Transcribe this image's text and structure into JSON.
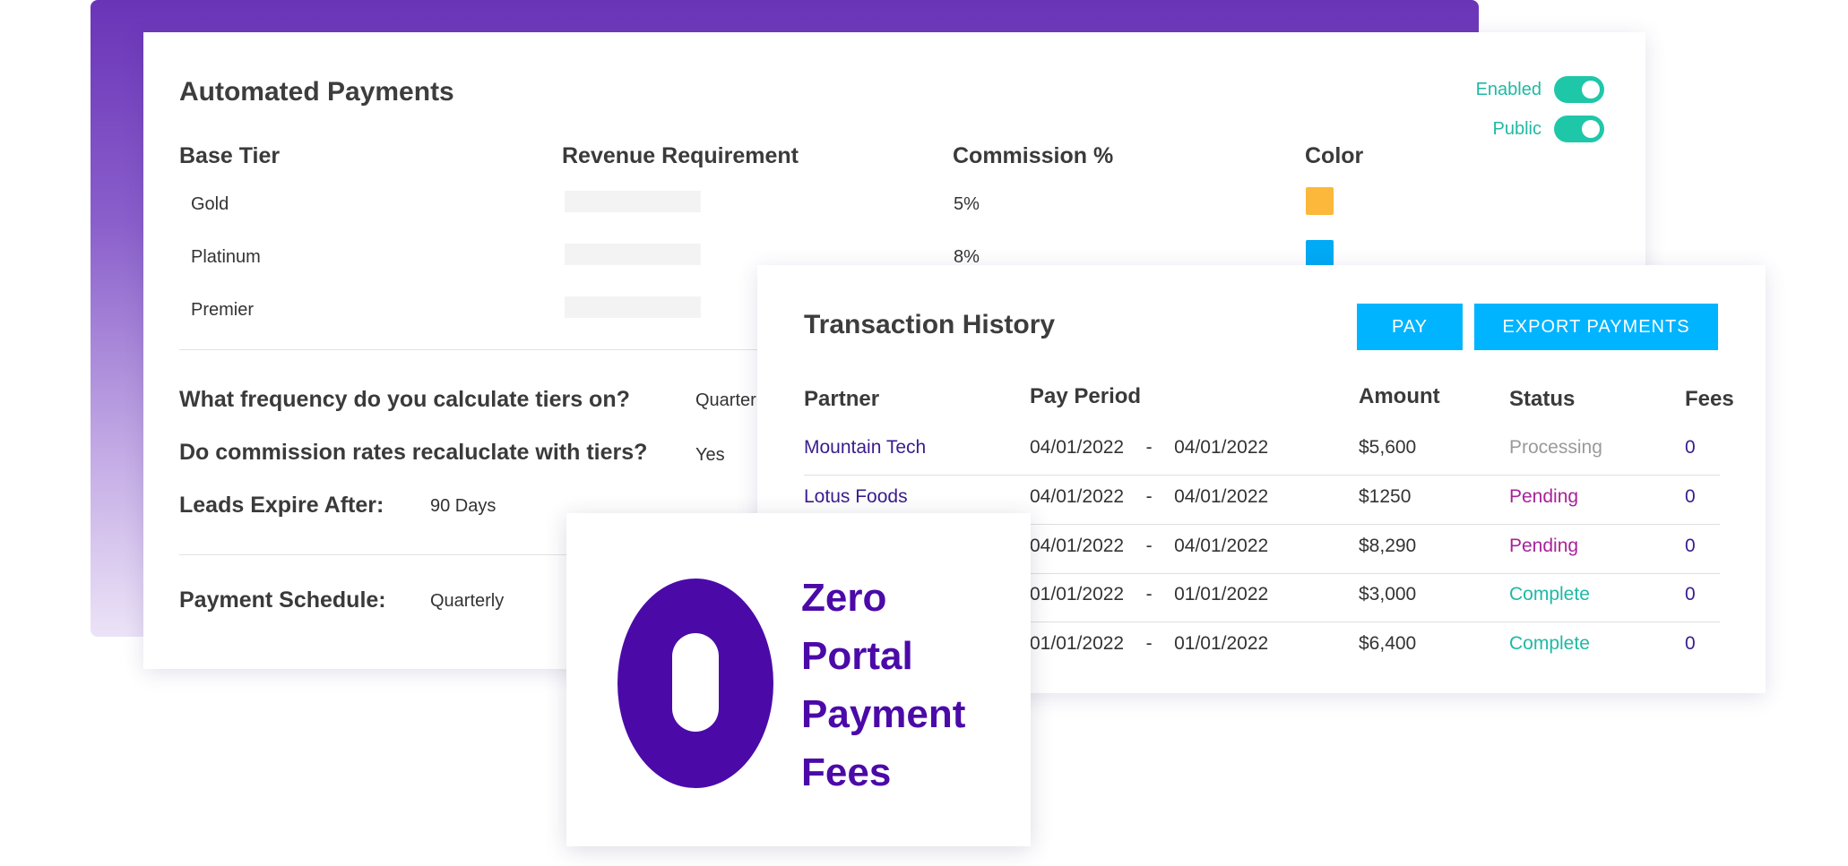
{
  "settings": {
    "title": "Automated Payments",
    "toggles": [
      {
        "label": "Enabled",
        "on": true
      },
      {
        "label": "Public",
        "on": true
      }
    ],
    "columns": [
      "Base Tier",
      "Revenue Requirement",
      "Commission %",
      "Color"
    ],
    "tiers": [
      {
        "name": "Gold",
        "commission": "5%",
        "color": "#fbb83a"
      },
      {
        "name": "Platinum",
        "commission": "8%",
        "color": "#00aaf5"
      },
      {
        "name": "Premier",
        "commission": "",
        "color": ""
      }
    ],
    "questions": [
      {
        "label": "What frequency do you calculate tiers on?",
        "value": "Quarterly"
      },
      {
        "label": "Do commission rates recaluclate with tiers?",
        "value": "Yes"
      },
      {
        "label": "Leads Expire After:",
        "value": "90 Days"
      }
    ],
    "schedule": {
      "label": "Payment Schedule:",
      "value": "Quarterly"
    }
  },
  "transactions": {
    "title": "Transaction History",
    "pay_label": "PAY",
    "export_label": "EXPORT PAYMENTS",
    "columns": {
      "partner": "Partner",
      "period": "Pay Period",
      "amount": "Amount",
      "status": "Status",
      "fees": "Fees"
    },
    "rows": [
      {
        "partner": "Mountain Tech",
        "start": "04/01/2022",
        "end": "04/01/2022",
        "amount": "$5,600",
        "status": "Processing",
        "fees": "0"
      },
      {
        "partner": "Lotus Foods",
        "start": "04/01/2022",
        "end": "04/01/2022",
        "amount": "$1250",
        "status": "Pending",
        "fees": "0"
      },
      {
        "partner": "",
        "start": "04/01/2022",
        "end": "04/01/2022",
        "amount": "$8,290",
        "status": "Pending",
        "fees": "0"
      },
      {
        "partner": "",
        "start": "01/01/2022",
        "end": "01/01/2022",
        "amount": "$3,000",
        "status": "Complete",
        "fees": "0"
      },
      {
        "partner": "",
        "start": "01/01/2022",
        "end": "01/01/2022",
        "amount": "$6,400",
        "status": "Complete",
        "fees": "0"
      }
    ],
    "dash": "-"
  },
  "promo": {
    "lines": [
      "Zero",
      "Portal",
      "Payment",
      "Fees"
    ],
    "accent": "#4b0aa8"
  },
  "colors": {
    "brand_purple": "#6a34b8",
    "toggle_green": "#1fc7a9",
    "button_blue": "#00b4ff",
    "pending": "#a8229a",
    "complete": "#1fb9a4",
    "processing": "#9a9a9a"
  }
}
